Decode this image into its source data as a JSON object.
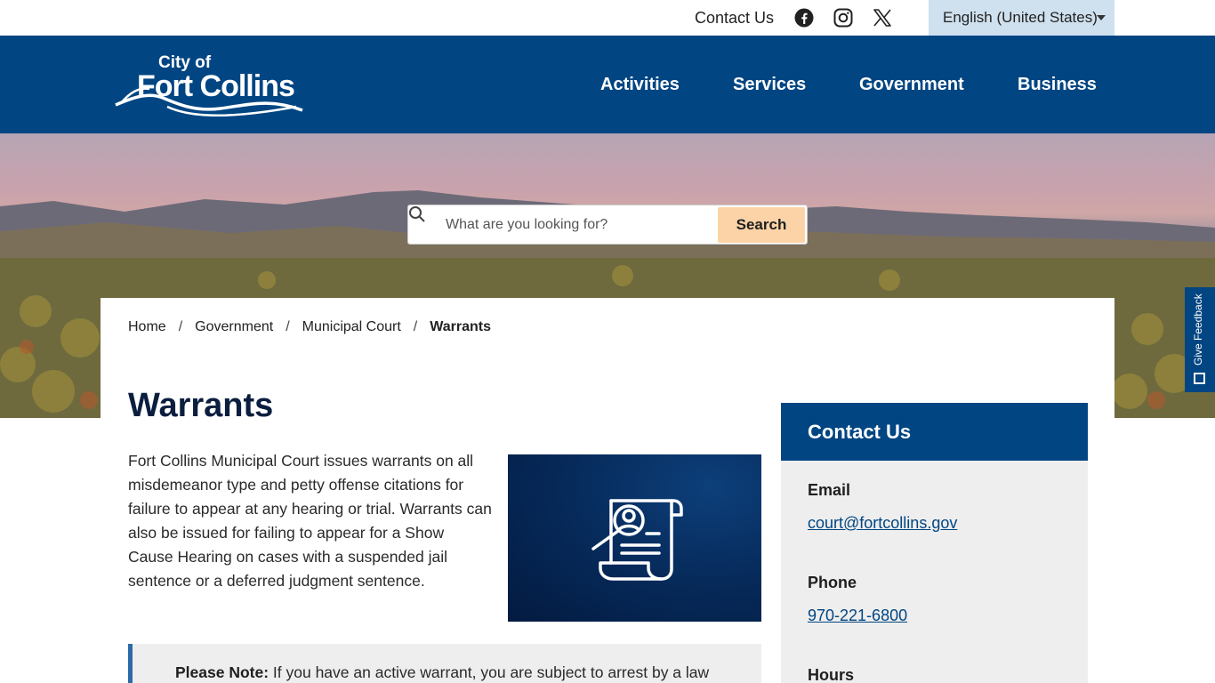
{
  "utility": {
    "contact_label": "Contact Us",
    "social": [
      "facebook-icon",
      "instagram-icon",
      "x-icon"
    ],
    "language": "English (United States)"
  },
  "header": {
    "logo_top": "City of",
    "logo_main": "Fort Collins",
    "nav": [
      "Activities",
      "Services",
      "Government",
      "Business"
    ]
  },
  "search": {
    "placeholder": "What are you looking for?",
    "button": "Search"
  },
  "feedback": {
    "label": "Give Feedback"
  },
  "breadcrumb": [
    "Home",
    "Government",
    "Municipal Court",
    "Warrants"
  ],
  "main": {
    "title": "Warrants",
    "intro": "Fort Collins Municipal Court issues warrants on all misdemeanor type and petty offense citations for failure to appear at any hearing or trial. Warrants can also be issued for failing to appear for a Show Cause Hearing on cases with a suspended jail sentence or a deferred judgment sentence.",
    "note_label": "Please Note:",
    "note_text": " If you have an active warrant, you are subject to arrest by a law"
  },
  "sidebar": {
    "title": "Contact Us",
    "email_label": "Email",
    "email": "court@fortcollins.gov",
    "phone_label": "Phone",
    "phone": "970-221-6800",
    "hours_label": "Hours"
  },
  "colors": {
    "brand_blue": "#014582",
    "search_button": "#fbd3a7",
    "language_bg": "#cfe0ee",
    "sidebar_bg": "#eeeeee"
  }
}
